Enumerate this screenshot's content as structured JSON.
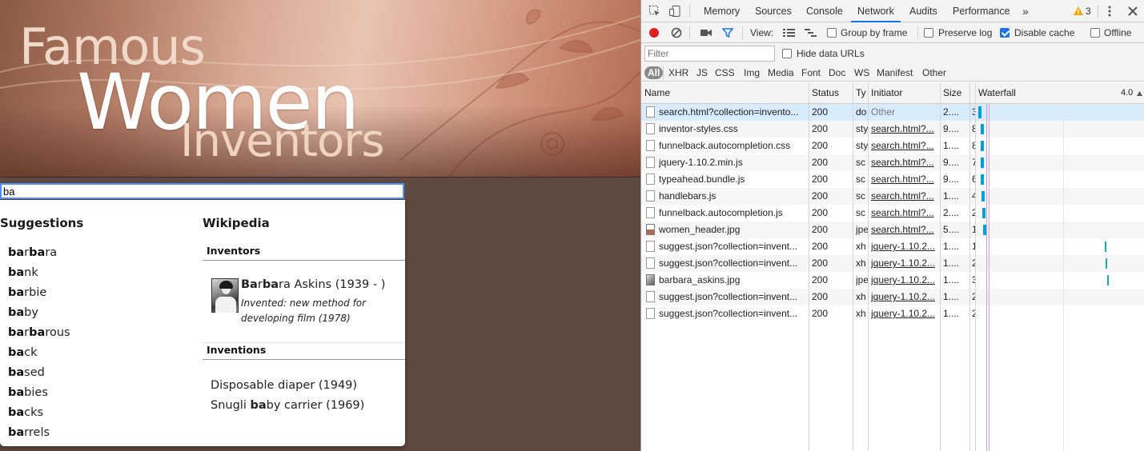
{
  "banner": {
    "line1": "Famous",
    "line2": "Women",
    "line3": "Inventors"
  },
  "search": {
    "value": "ba"
  },
  "dropdown": {
    "suggestions_title": "Suggestions",
    "suggestions": [
      {
        "bold1": "ba",
        "mid": "r",
        "bold2": "ba",
        "rest": "ra"
      },
      {
        "bold1": "ba",
        "mid": "",
        "bold2": "",
        "rest": "nk"
      },
      {
        "bold1": "ba",
        "mid": "",
        "bold2": "",
        "rest": "rbie"
      },
      {
        "bold1": "ba",
        "mid": "",
        "bold2": "",
        "rest": "by"
      },
      {
        "bold1": "ba",
        "mid": "r",
        "bold2": "ba",
        "rest": "rous"
      },
      {
        "bold1": "ba",
        "mid": "",
        "bold2": "",
        "rest": "ck"
      },
      {
        "bold1": "ba",
        "mid": "",
        "bold2": "",
        "rest": "sed"
      },
      {
        "bold1": "ba",
        "mid": "",
        "bold2": "",
        "rest": "bies"
      },
      {
        "bold1": "ba",
        "mid": "",
        "bold2": "",
        "rest": "cks"
      },
      {
        "bold1": "ba",
        "mid": "",
        "bold2": "",
        "rest": "rrels"
      }
    ],
    "wikipedia_title": "Wikipedia",
    "inventors_head": "Inventors",
    "inventor": {
      "bold1": "Ba",
      "mid": "r",
      "bold2": "ba",
      "rest": "ra Askins (1939 - )",
      "desc": "Invented: new method for developing film (1978)"
    },
    "inventions_head": "Inventions",
    "inventions": [
      {
        "pre": "Disposable diaper (1949)",
        "bold": "",
        "post": ""
      },
      {
        "pre": "Snugli ",
        "bold": "ba",
        "post": "by carrier (1969)"
      }
    ]
  },
  "devtools": {
    "tabs": [
      "Memory",
      "Sources",
      "Console",
      "Network",
      "Audits",
      "Performance"
    ],
    "active_tab": "Network",
    "more_tabs": "»",
    "warning_count": "3",
    "toolbar": {
      "view_label": "View:",
      "group_by_frame": "Group by frame",
      "preserve_log": "Preserve log",
      "disable_cache": "Disable cache",
      "offline": "Offline"
    },
    "filter_placeholder": "Filter",
    "hide_data_urls": "Hide data URLs",
    "types": [
      "All",
      "XHR",
      "JS",
      "CSS",
      "Img",
      "Media",
      "Font",
      "Doc",
      "WS",
      "Manifest",
      "Other"
    ],
    "columns": [
      "Name",
      "Status",
      "Ty",
      "Initiator",
      "Size",
      "",
      "Waterfall",
      "4.0"
    ],
    "rows": [
      {
        "name": "search.html?collection=invento...",
        "status": "200",
        "type": "do",
        "initiator": "Other",
        "size": "2....",
        "time": "3",
        "icon": "doc"
      },
      {
        "name": "inventor-styles.css",
        "status": "200",
        "type": "sty",
        "initiator": "search.html?...",
        "size": "9....",
        "time": "8",
        "icon": "doc"
      },
      {
        "name": "funnelback.autocompletion.css",
        "status": "200",
        "type": "sty",
        "initiator": "search.html?...",
        "size": "1....",
        "time": "8",
        "icon": "doc"
      },
      {
        "name": "jquery-1.10.2.min.js",
        "status": "200",
        "type": "sc",
        "initiator": "search.html?...",
        "size": "9....",
        "time": "7",
        "icon": "doc"
      },
      {
        "name": "typeahead.bundle.js",
        "status": "200",
        "type": "sc",
        "initiator": "search.html?...",
        "size": "9....",
        "time": "6",
        "icon": "doc"
      },
      {
        "name": "handlebars.js",
        "status": "200",
        "type": "sc",
        "initiator": "search.html?...",
        "size": "1....",
        "time": "4",
        "icon": "doc"
      },
      {
        "name": "funnelback.autocompletion.js",
        "status": "200",
        "type": "sc",
        "initiator": "search.html?...",
        "size": "2....",
        "time": "2",
        "icon": "doc"
      },
      {
        "name": "women_header.jpg",
        "status": "200",
        "type": "jpe",
        "initiator": "search.html?...",
        "size": "5....",
        "time": "1",
        "icon": "img"
      },
      {
        "name": "suggest.json?collection=invent...",
        "status": "200",
        "type": "xh",
        "initiator": "jquery-1.10.2...",
        "size": "1....",
        "time": "1",
        "icon": "doc"
      },
      {
        "name": "suggest.json?collection=invent...",
        "status": "200",
        "type": "xh",
        "initiator": "jquery-1.10.2...",
        "size": "1....",
        "time": "2",
        "icon": "doc"
      },
      {
        "name": "barbara_askins.jpg",
        "status": "200",
        "type": "jpe",
        "initiator": "jquery-1.10.2...",
        "size": "1....",
        "time": "3",
        "icon": "photo"
      },
      {
        "name": "suggest.json?collection=invent...",
        "status": "200",
        "type": "xh",
        "initiator": "jquery-1.10.2...",
        "size": "1....",
        "time": "2",
        "icon": "doc"
      },
      {
        "name": "suggest.json?collection=invent...",
        "status": "200",
        "type": "xh",
        "initiator": "jquery-1.10.2...",
        "size": "1....",
        "time": "2",
        "icon": "doc"
      }
    ]
  },
  "colors": {
    "accent": "#1a73e8",
    "record": "#e0201e",
    "warning": "#f2a400",
    "waterfall": "#00a0e0",
    "xhr_bar": "#16b19a"
  }
}
